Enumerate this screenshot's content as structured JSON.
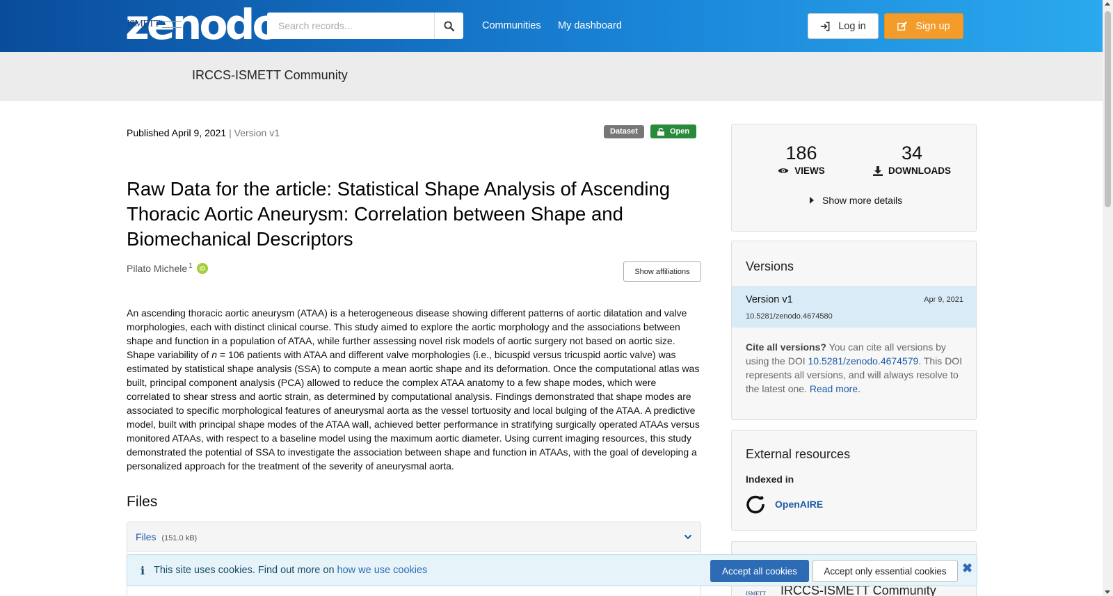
{
  "header": {
    "logo_text": "zenodo",
    "search_placeholder": "Search records...",
    "nav": [
      "Communities",
      "My dashboard"
    ],
    "login_label": "Log in",
    "signup_label": "Sign up"
  },
  "community": {
    "logo_text": "ISMETT",
    "name": "IRCCS-ISMETT Community"
  },
  "record": {
    "published": "Published April 9, 2021",
    "version": "| Version v1",
    "resource_type": "Dataset",
    "access": "Open",
    "title": "Raw Data for the article: Statistical Shape Analysis of Ascending Thoracic Aortic Aneurysm: Correlation between Shape and Biomechanical Descriptors",
    "author": "Pilato Michele",
    "author_sup": "1",
    "show_affiliations_label": "Show affiliations",
    "abstract_before_n": "An ascending thoracic aortic aneurysm (ATAA) is a heterogeneous disease showing different patterns of aortic dilatation and valve morphologies, each with distinct clinical course. This study aimed to explore the aortic morphology and the associations between shape and function in a population of ATAA, while further assessing novel risk models of aortic surgery not based on aortic size. Shape variability of ",
    "abstract_n": "n",
    "abstract_after_n": " = 106 patients with ATAA and different valve morphologies (i.e., bicuspid versus tricuspid aortic valve) was estimated by statistical shape analysis (SSA) to compute a mean aortic shape and its deformation. Once the computational atlas was built, principal component analysis (PCA) allowed to reduce the complex ATAA anatomy to a few shape modes, which were correlated to shear stress and aortic strain, as determined by computational analysis. Findings demonstrated that shape modes are associated to specific morphological features of aneurysmal aorta as the vessel tortuosity and local bulging of the ATAA. A predictive model, built with principal shape modes of the ATAA wall, achieved better performance in stratifying surgically operated ATAAs versus monitored ATAAs, with respect to a baseline model using the maximum aortic diameter. Using current imaging resources, this study demonstrated the potential of SSA to investigate the association between shape and function in ATAAs, with the goal of developing a personalized approach for the treatment of the severity of aneurysmal aorta.",
    "files_heading": "Files",
    "files_label": "Files",
    "files_size": "(151.0 kB)"
  },
  "sidebar": {
    "views_count": "186",
    "views_label": "VIEWS",
    "downloads_count": "34",
    "downloads_label": "DOWNLOADS",
    "show_more_label": "Show more details",
    "versions_heading": "Versions",
    "version_name": "Version v1",
    "version_date": "Apr 9, 2021",
    "version_doi": "10.5281/zenodo.4674580",
    "cite_bold": "Cite all versions?",
    "cite_text1": " You can cite all versions by using the DOI ",
    "cite_doi": "10.5281/zenodo.4674579",
    "cite_text2": ". This DOI represents all versions, and will always resolve to the latest one. ",
    "read_more": "Read more.",
    "external_heading": "External resources",
    "indexed_in": "Indexed in",
    "openaire": "OpenAIRE",
    "community_card_title": "IRCCS-ISMETT Community",
    "community_card_logo": "ISMETT"
  },
  "cookie": {
    "message": "This site uses cookies. Find out more on ",
    "link": "how we use cookies",
    "accept_all": "Accept all cookies",
    "accept_essential": "Accept only essential cookies"
  },
  "colors": {
    "brand_blue": "#0a4c9c",
    "signup_orange": "#f39c2a",
    "open_green": "#2a8a3c",
    "link_blue": "#1d5aa6"
  }
}
